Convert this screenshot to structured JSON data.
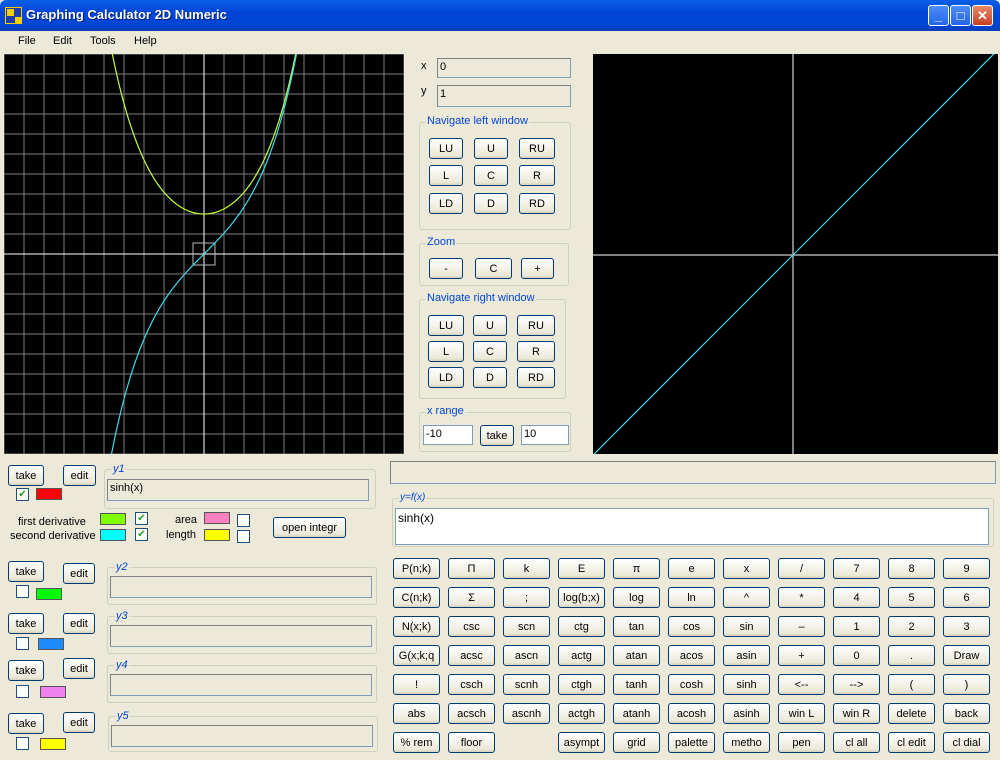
{
  "window": {
    "title": "Graphing Calculator 2D Numeric"
  },
  "menu": [
    "File",
    "Edit",
    "Tools",
    "Help"
  ],
  "coords": {
    "x_label": "x",
    "x_value": "0",
    "y_label": "y",
    "y_value": "1"
  },
  "nav_left": {
    "title": "Navigate left window",
    "buttons": [
      "LU",
      "U",
      "RU",
      "L",
      "C",
      "R",
      "LD",
      "D",
      "RD"
    ]
  },
  "zoom": {
    "title": "Zoom",
    "buttons": [
      "-",
      "C",
      "+"
    ]
  },
  "nav_right": {
    "title": "Navigate right window",
    "buttons": [
      "LU",
      "U",
      "RU",
      "L",
      "C",
      "R",
      "LD",
      "D",
      "RD"
    ]
  },
  "xrange": {
    "title": "x range",
    "min": "-10",
    "take": "take",
    "max": "10"
  },
  "functions": [
    {
      "take": "take",
      "edit": "edit",
      "label": "y1",
      "value": "sinh(x)",
      "checked": true,
      "color": "#ff0000"
    },
    {
      "take": "take",
      "edit": "edit",
      "label": "y2",
      "value": "",
      "checked": false,
      "color": "#00ff00"
    },
    {
      "take": "take",
      "edit": "edit",
      "label": "y3",
      "value": "",
      "checked": false,
      "color": "#1e8cff"
    },
    {
      "take": "take",
      "edit": "edit",
      "label": "y4",
      "value": "",
      "checked": false,
      "color": "#ee82ee"
    },
    {
      "take": "take",
      "edit": "edit",
      "label": "y5",
      "value": "",
      "checked": false,
      "color": "#ffff00"
    }
  ],
  "derivs": {
    "first": "first derivative",
    "second": "second derivative",
    "first_color": "#80ff00",
    "second_color": "#00ffff",
    "area": "area",
    "length": "length",
    "area_color": "#ff80c0",
    "length_color": "#ffff00",
    "open": "open integr"
  },
  "expr": {
    "label": "y=f(x)",
    "value": "sinh(x)"
  },
  "keypad": [
    [
      "P(n;k)",
      "Π",
      "k",
      "E",
      "π",
      "e",
      "x",
      "/",
      "7",
      "8",
      "9"
    ],
    [
      "C(n;k)",
      "Σ",
      ";",
      "log(b;x)",
      "log",
      "ln",
      "^",
      "*",
      "4",
      "5",
      "6"
    ],
    [
      "N(x;k)",
      "csc",
      "scn",
      "ctg",
      "tan",
      "cos",
      "sin",
      "–",
      "1",
      "2",
      "3"
    ],
    [
      "G(x;k;q",
      "acsc",
      "ascn",
      "actg",
      "atan",
      "acos",
      "asin",
      "+",
      "0",
      ".",
      "Draw"
    ],
    [
      "!",
      "csch",
      "scnh",
      "ctgh",
      "tanh",
      "cosh",
      "sinh",
      "<--",
      "-->",
      "(",
      ")"
    ],
    [
      "abs",
      "acsch",
      "ascnh",
      "actgh",
      "atanh",
      "acosh",
      "asinh",
      "win L",
      "win R",
      "delete",
      "back"
    ],
    [
      "% rem",
      "floor",
      "",
      "asympt",
      "grid",
      "palette",
      "metho",
      "pen",
      "cl all",
      "cl edit",
      "cl dial"
    ]
  ],
  "colors": {
    "plot_bg": "#000000",
    "grid": "#808080",
    "axis": "#ffffff",
    "cosh_curve": "#c0ff40",
    "sinh_curve": "#40d8f0"
  }
}
